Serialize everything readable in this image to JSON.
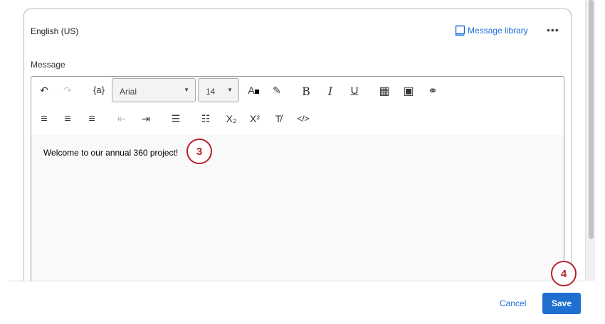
{
  "header": {
    "language": "English (US)",
    "message_library": "Message library",
    "more": "•••"
  },
  "message_label": "Message",
  "toolbar": {
    "undo": "↶",
    "redo": "↷",
    "piped_text": "{a}",
    "font": "Arial",
    "font_size": "14",
    "text_color": "A",
    "highlight": "✎",
    "bold": "B",
    "italic": "I",
    "underline": "U",
    "table": "▦",
    "image": "▣",
    "link": "⚭",
    "align_left": "≡",
    "align_center": "≡",
    "align_right": "≡",
    "outdent": "⇤",
    "indent": "⇥",
    "bullet_list": "☰",
    "numbered_list": "☷",
    "subscript": "X₂",
    "superscript": "X²",
    "clear_format": "T̸",
    "source": "</>"
  },
  "content": "Welcome to our annual 360 project!",
  "badges": [
    "3",
    "4"
  ],
  "footer": {
    "cancel": "Cancel",
    "save": "Save"
  }
}
